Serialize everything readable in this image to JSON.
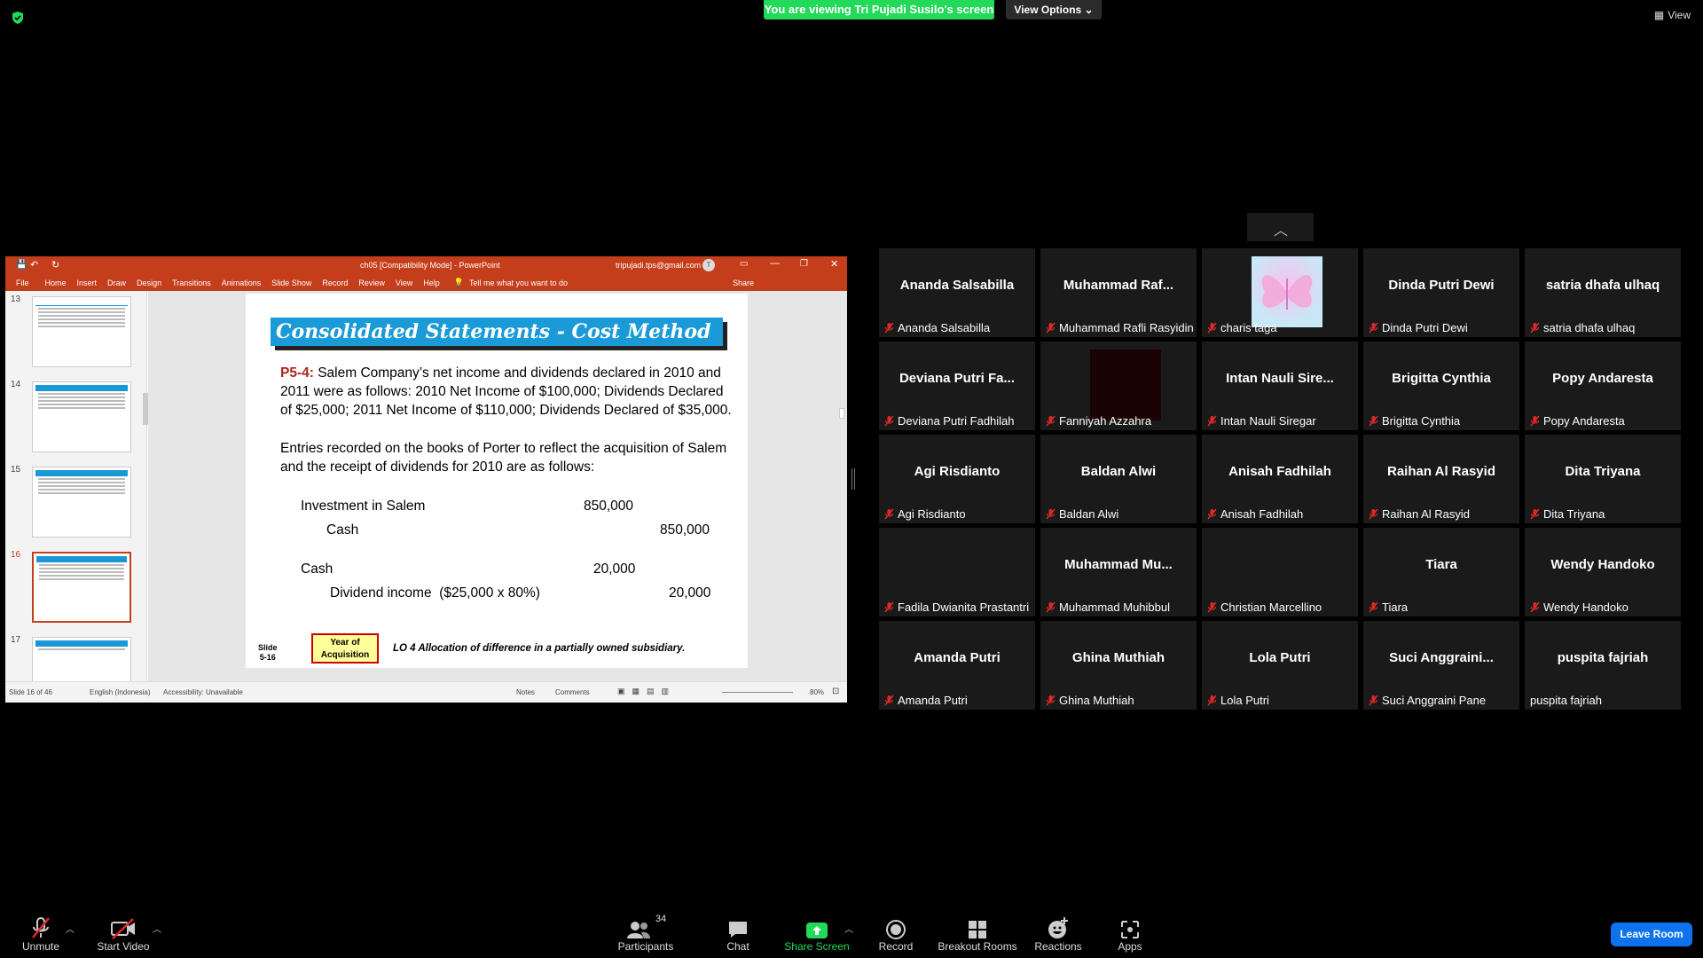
{
  "banner": {
    "viewing_text": "You are viewing Tri Pujadi Susilo's screen",
    "view_options": "View Options ⌄",
    "view_label": "View"
  },
  "ppt": {
    "title": "ch05 [Compatibility Mode] - PowerPoint",
    "account": "tripujadi.tps@gmail.com",
    "account_initial": "T",
    "ribbon_tabs": [
      "File",
      "Home",
      "Insert",
      "Draw",
      "Design",
      "Transitions",
      "Animations",
      "Slide Show",
      "Record",
      "Review",
      "View",
      "Help"
    ],
    "tell_me": "Tell me what you want to do",
    "share": "Share",
    "thumbs": [
      {
        "num": "13",
        "active": false
      },
      {
        "num": "14",
        "active": false
      },
      {
        "num": "15",
        "active": false
      },
      {
        "num": "16",
        "active": true
      },
      {
        "num": "17",
        "active": false
      }
    ],
    "slide": {
      "title": "Consolidated Statements - Cost Method",
      "problem_label": "P5-4:",
      "problem_text": "Salem Company’s net income and dividends declared in 2010 and 2011 were as follows: 2010 Net Income of $100,000; Dividends Declared of $25,000; 2011 Net Income of $110,000; Dividends Declared of $35,000.",
      "entries_text": "Entries recorded on the books of Porter to reflect the acquisition of Salem and the receipt of dividends for 2010 are as follows:",
      "je1_debit_account": "Investment in Salem",
      "je1_debit_amount": "850,000",
      "je1_credit_account": "Cash",
      "je1_credit_amount": "850,000",
      "je2_debit_account": "Cash",
      "je2_debit_amount": "20,000",
      "je2_credit_account": "Dividend income  ($25,000 x 80%)",
      "je2_credit_amount": "20,000",
      "footer_slide": "Slide",
      "footer_num": "5-16",
      "year_box": "Year of Acquisition",
      "lo_text": "LO 4  Allocation of difference in a partially owned subsidiary."
    },
    "status": {
      "slide_of": "Slide 16 of 46",
      "language": "English (Indonesia)",
      "accessibility": "Accessibility: Unavailable",
      "notes": "Notes",
      "comments": "Comments",
      "zoom": "80%"
    }
  },
  "participants": [
    {
      "big": "Ananda Salsabilla",
      "label": "Ananda Salsabilla",
      "muted": true,
      "type": "name"
    },
    {
      "big": "Muhammad  Raf...",
      "label": "Muhammad Rafli Rasyidin",
      "muted": true,
      "type": "name"
    },
    {
      "big": "",
      "label": "charis taga",
      "muted": true,
      "type": "butterfly"
    },
    {
      "big": "Dinda Putri Dewi",
      "label": "Dinda Putri Dewi",
      "muted": true,
      "type": "name"
    },
    {
      "big": "satria dhafa ulhaq",
      "label": "satria dhafa ulhaq",
      "muted": true,
      "type": "name"
    },
    {
      "big": "Deviana  Putri  Fa...",
      "label": "Deviana Putri Fadhilah",
      "muted": true,
      "type": "name"
    },
    {
      "big": "",
      "label": "Fanniyah Azzahra",
      "muted": true,
      "type": "dark"
    },
    {
      "big": "Intan  Nauli  Sire...",
      "label": "Intan Nauli Siregar",
      "muted": true,
      "type": "name"
    },
    {
      "big": "Brigitta Cynthia",
      "label": "Brigitta Cynthia",
      "muted": true,
      "type": "name"
    },
    {
      "big": "Popy Andaresta",
      "label": "Popy Andaresta",
      "muted": true,
      "type": "name"
    },
    {
      "big": "Agi Risdianto",
      "label": "Agi Risdianto",
      "muted": true,
      "type": "name"
    },
    {
      "big": "Baldan Alwi",
      "label": "Baldan Alwi",
      "muted": true,
      "type": "name"
    },
    {
      "big": "Anisah Fadhilah",
      "label": "Anisah Fadhilah",
      "muted": true,
      "type": "name"
    },
    {
      "big": "Raihan Al Rasyid",
      "label": "Raihan Al Rasyid",
      "muted": true,
      "type": "name"
    },
    {
      "big": "Dita Triyana",
      "label": "Dita Triyana",
      "muted": true,
      "type": "name"
    },
    {
      "big": "",
      "label": "Fadila Dwianita Prastantri",
      "muted": true,
      "type": "blank"
    },
    {
      "big": "Muhammad  Mu...",
      "label": "Muhammad Muhibbul",
      "muted": true,
      "type": "name"
    },
    {
      "big": "",
      "label": "Christian Marcellino",
      "muted": true,
      "type": "blank"
    },
    {
      "big": "Tiara",
      "label": "Tiara",
      "muted": true,
      "type": "name"
    },
    {
      "big": "Wendy Handoko",
      "label": "Wendy Handoko",
      "muted": true,
      "type": "name"
    },
    {
      "big": "Amanda Putri",
      "label": "Amanda Putri",
      "muted": true,
      "type": "name"
    },
    {
      "big": "Ghina Muthiah",
      "label": "Ghina Muthiah",
      "muted": true,
      "type": "name"
    },
    {
      "big": "Lola Putri",
      "label": "Lola Putri",
      "muted": true,
      "type": "name"
    },
    {
      "big": "Suci  Anggraini...",
      "label": "Suci Anggraini Pane",
      "muted": true,
      "type": "name"
    },
    {
      "big": "puspita fajriah",
      "label": "puspita fajriah",
      "muted": false,
      "type": "name"
    }
  ],
  "toolbar": {
    "unmute": "Unmute",
    "start_video": "Start Video",
    "participants": "Participants",
    "participants_count": "34",
    "chat": "Chat",
    "share_screen": "Share Screen",
    "record": "Record",
    "breakout_rooms": "Breakout Rooms",
    "reactions": "Reactions",
    "apps": "Apps",
    "leave_room": "Leave Room"
  }
}
